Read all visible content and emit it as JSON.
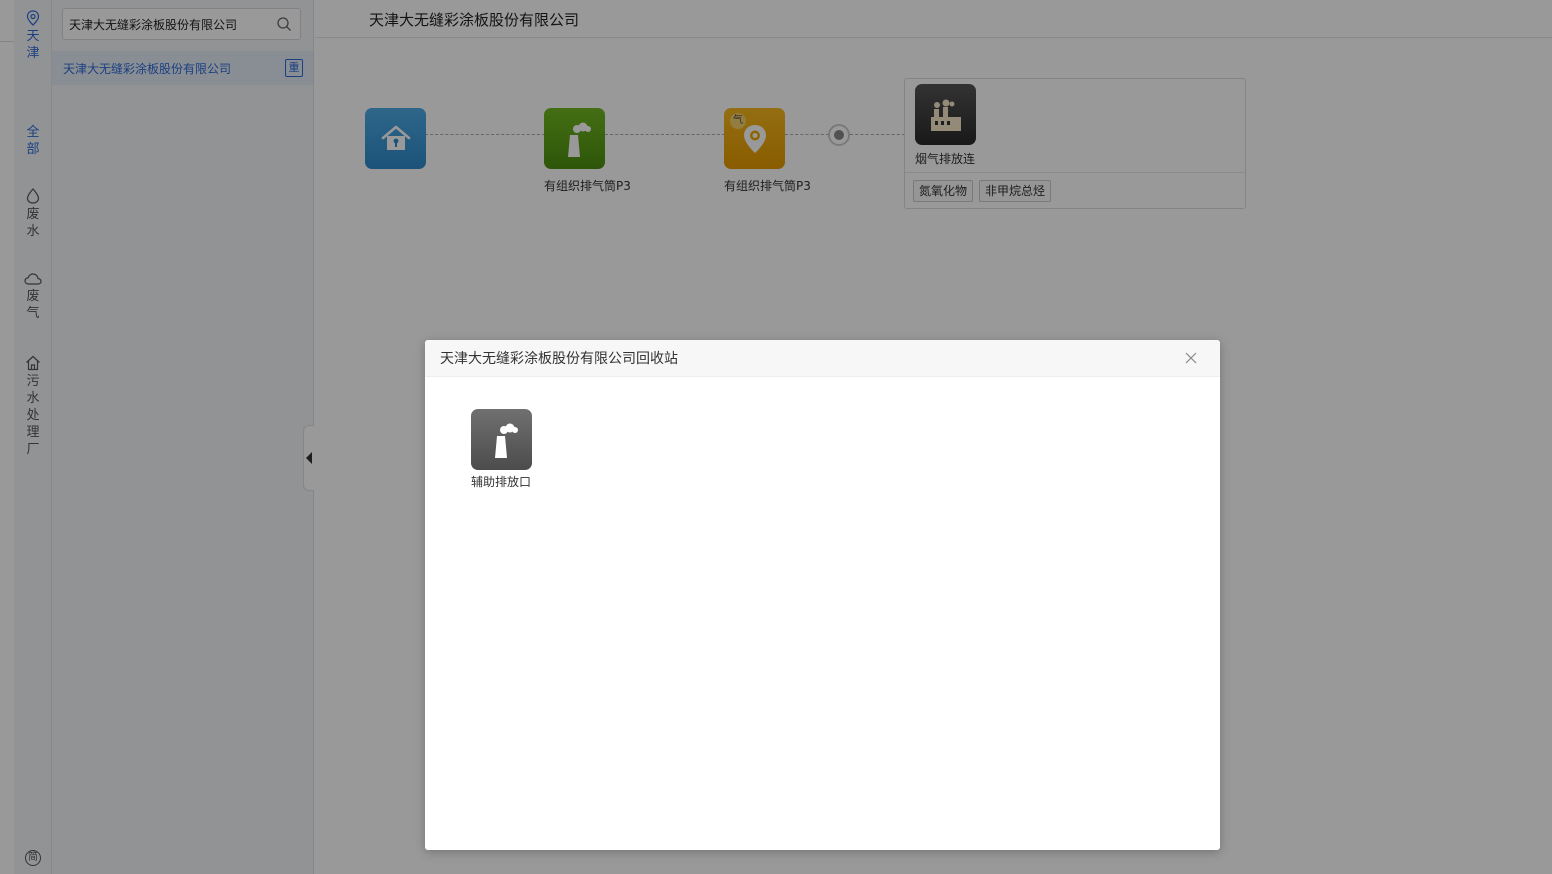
{
  "nav": {
    "region": [
      "天",
      "津"
    ],
    "all": [
      "全",
      "部"
    ],
    "wastewater": [
      "废",
      "水"
    ],
    "wastegas": [
      "废",
      "气"
    ],
    "sewage_plant": [
      "污",
      "水",
      "处",
      "理",
      "厂"
    ],
    "bottom_icon_char": "简"
  },
  "sidebar": {
    "search_value": "天津大无缝彩涂板股份有限公司",
    "items": [
      {
        "label": "天津大无缝彩涂板股份有限公司",
        "badge": "重"
      }
    ]
  },
  "main": {
    "title": "天津大无缝彩涂板股份有限公司",
    "flow": {
      "nodes": [
        {
          "icon": "house-icon",
          "color": "#3a9ad9",
          "label": ""
        },
        {
          "icon": "chimney-icon",
          "color": "#5fa416",
          "label": "有组织排气筒P3"
        },
        {
          "icon": "location-pin-icon",
          "color": "#f0a400",
          "badge": "气",
          "label": "有组织排气筒P3"
        }
      ],
      "outlet": {
        "icon": "factory-icon",
        "color": "#333333",
        "label": "烟气排放连",
        "tags": [
          "氮氧化物",
          "非甲烷总烃"
        ]
      }
    }
  },
  "modal": {
    "title": "天津大无缝彩涂板股份有限公司回收站",
    "item": {
      "icon": "chimney-icon",
      "label": "辅助排放口"
    }
  }
}
